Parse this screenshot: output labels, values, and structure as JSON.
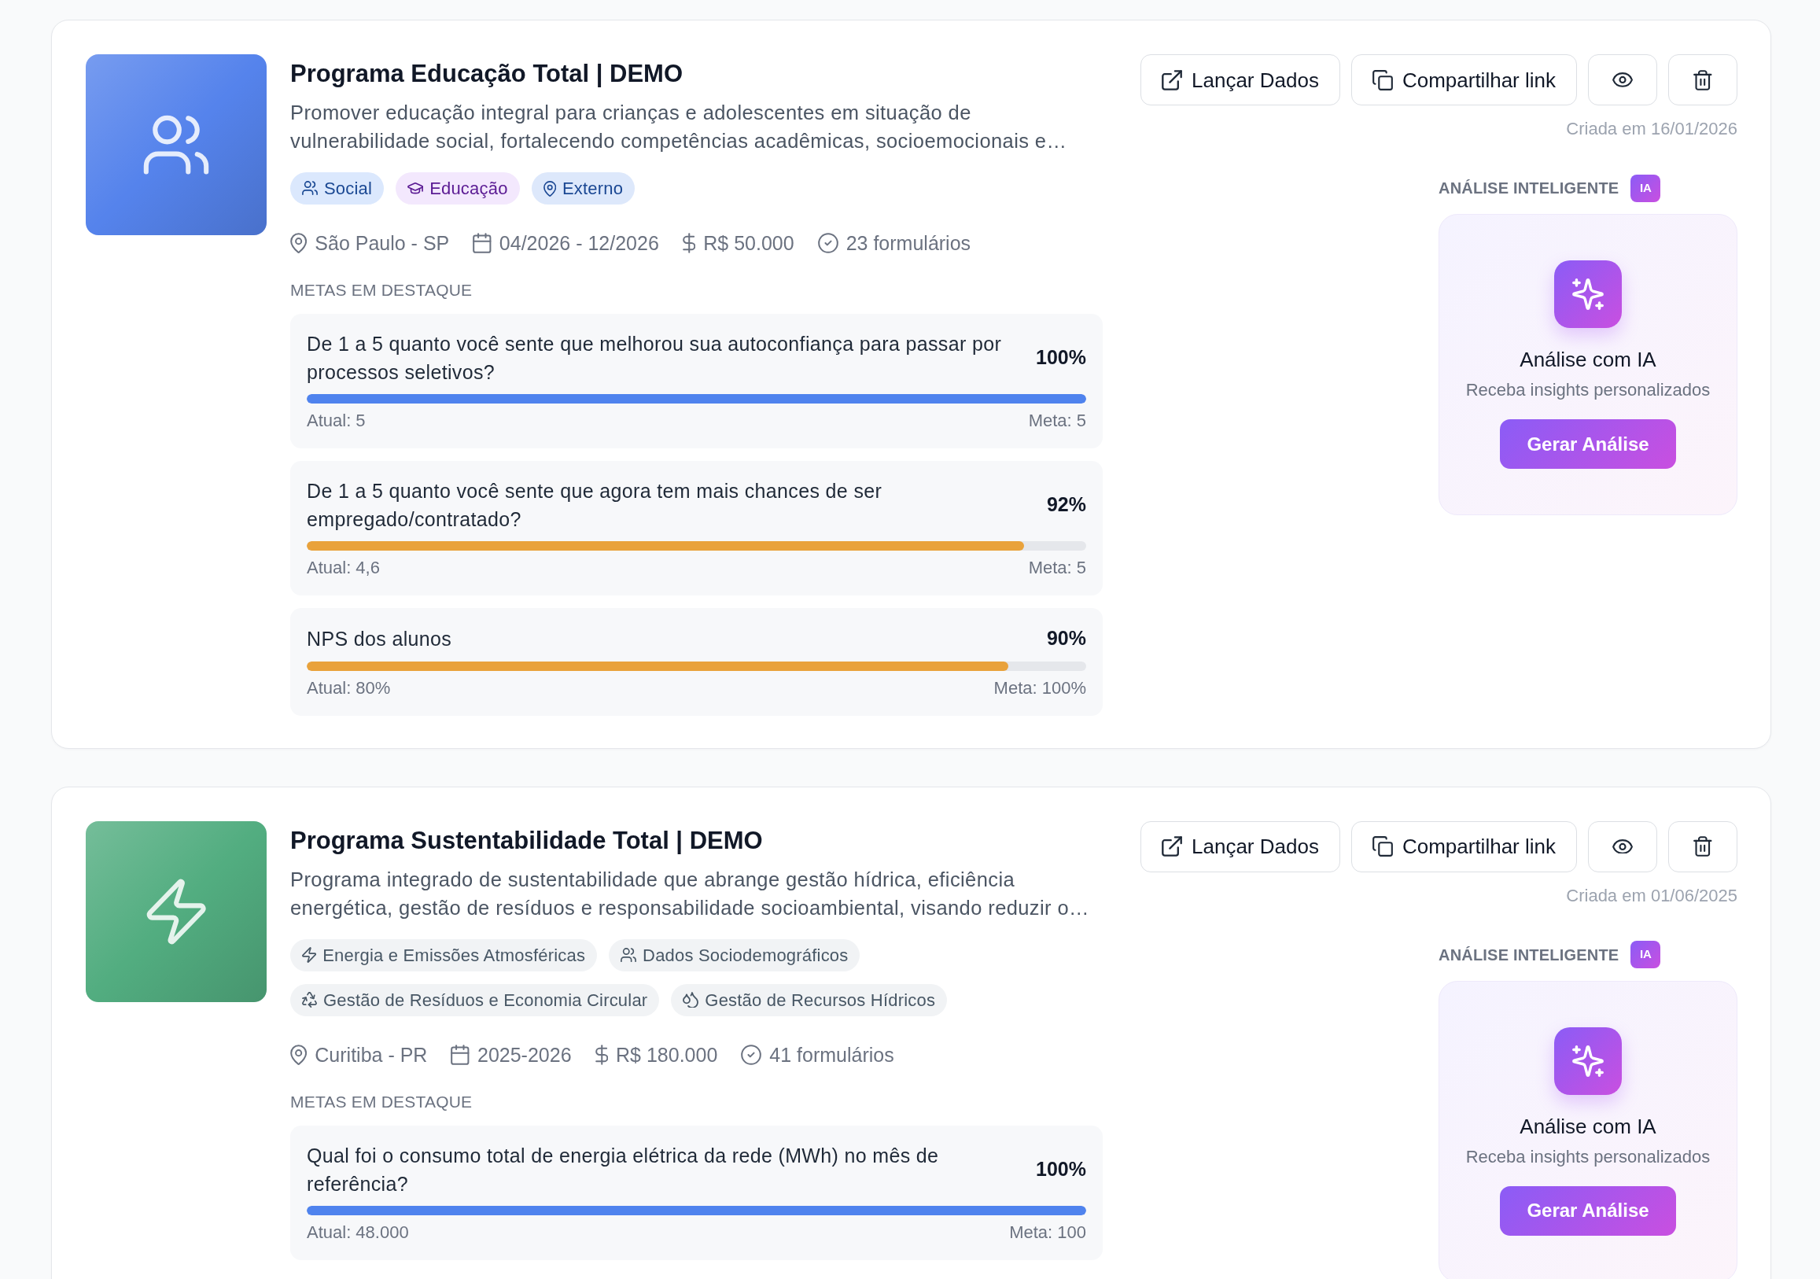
{
  "cards": [
    {
      "kind": "people",
      "color": "#5583ec",
      "title": "Programa Educação Total | DEMO",
      "description": "Promover educação integral para crianças e adolescentes em situação de vulnerabilidade social, fortalecendo competências acadêmicas, socioemocionais e…",
      "tags": [
        {
          "kind": "people",
          "label": "Social",
          "color": "#dbe8fd"
        },
        {
          "kind": "education",
          "label": "Educação",
          "color": "#f3e8fd"
        },
        {
          "kind": "place",
          "label": "Externo",
          "color": "#dde8fb"
        }
      ],
      "details": [
        {
          "kind": "place",
          "label": "São Paulo - SP"
        },
        {
          "kind": "period",
          "label": "04/2026 - 12/2026"
        },
        {
          "kind": "budget",
          "label": "R$ 50.000"
        },
        {
          "kind": "forms",
          "label": "23 formulários"
        }
      ],
      "goals_heading": "METAS EM DESTAQUE",
      "goals": [
        {
          "question": "De 1 a 5 quanto você sente que melhorou sua autoconfiança para passar por processos seletivos?",
          "percent": "100%",
          "level": 1,
          "color": "#4f83ee",
          "current": "Atual: 5",
          "target": "Meta: 5"
        },
        {
          "question": "De 1 a 5 quanto você sente que agora tem mais chances de ser empregado/contratado?",
          "percent": "92%",
          "level": 0.92,
          "color": "#e9a23b",
          "current": "Atual: 4,6",
          "target": "Meta: 5"
        },
        {
          "question": "NPS dos alunos",
          "percent": "90%",
          "level": 0.9,
          "color": "#e9a23b",
          "current": "Atual: 80%",
          "target": "Meta: 100%"
        }
      ],
      "actions": [
        {
          "kind": "launch",
          "label": "Lançar Dados"
        },
        {
          "kind": "share",
          "label": "Compartilhar link"
        },
        {
          "kind": "view"
        },
        {
          "kind": "delete"
        }
      ],
      "created": "Criada em 16/01/2026",
      "ai": {
        "heading": "ANÁLISE INTELIGENTE",
        "tag": "IA",
        "title": "Análise com IA",
        "subtitle": "Receba insights personalizados",
        "button": "Gerar Análise"
      }
    },
    {
      "kind": "energy",
      "color": "#52ad80",
      "title": "Programa Sustentabilidade Total | DEMO",
      "description": "Programa integrado de sustentabilidade que abrange gestão hídrica, eficiência energética, gestão de resíduos e responsabilidade socioambiental, visando reduzir o…",
      "tags": [
        {
          "kind": "energy",
          "label": "Energia e Emissões Atmosféricas",
          "color": "#f1f3f5"
        },
        {
          "kind": "people",
          "label": "Dados Sociodemográficos",
          "color": "#f1f3f5"
        },
        {
          "kind": "waste",
          "label": "Gestão de Resíduos e Economia Circular",
          "color": "#f1f3f5"
        },
        {
          "kind": "water",
          "label": "Gestão de Recursos Hídricos",
          "color": "#f1f3f5"
        }
      ],
      "details": [
        {
          "kind": "place",
          "label": "Curitiba - PR"
        },
        {
          "kind": "period",
          "label": "2025-2026"
        },
        {
          "kind": "budget",
          "label": "R$ 180.000"
        },
        {
          "kind": "forms",
          "label": "41 formulários"
        }
      ],
      "goals_heading": "METAS EM DESTAQUE",
      "goals": [
        {
          "question": "Qual foi o consumo total de energia elétrica da rede (MWh) no mês de referência?",
          "percent": "100%",
          "level": 1,
          "color": "#4f83ee",
          "current": "Atual: 48.000",
          "target": "Meta: 100"
        }
      ],
      "actions": [
        {
          "kind": "launch",
          "label": "Lançar Dados"
        },
        {
          "kind": "share",
          "label": "Compartilhar link"
        },
        {
          "kind": "view"
        },
        {
          "kind": "delete"
        }
      ],
      "created": "Criada em 01/06/2025",
      "ai": {
        "heading": "ANÁLISE INTELIGENTE",
        "tag": "IA",
        "title": "Análise com IA",
        "subtitle": "Receba insights personalizados",
        "button": "Gerar Análise"
      }
    }
  ]
}
